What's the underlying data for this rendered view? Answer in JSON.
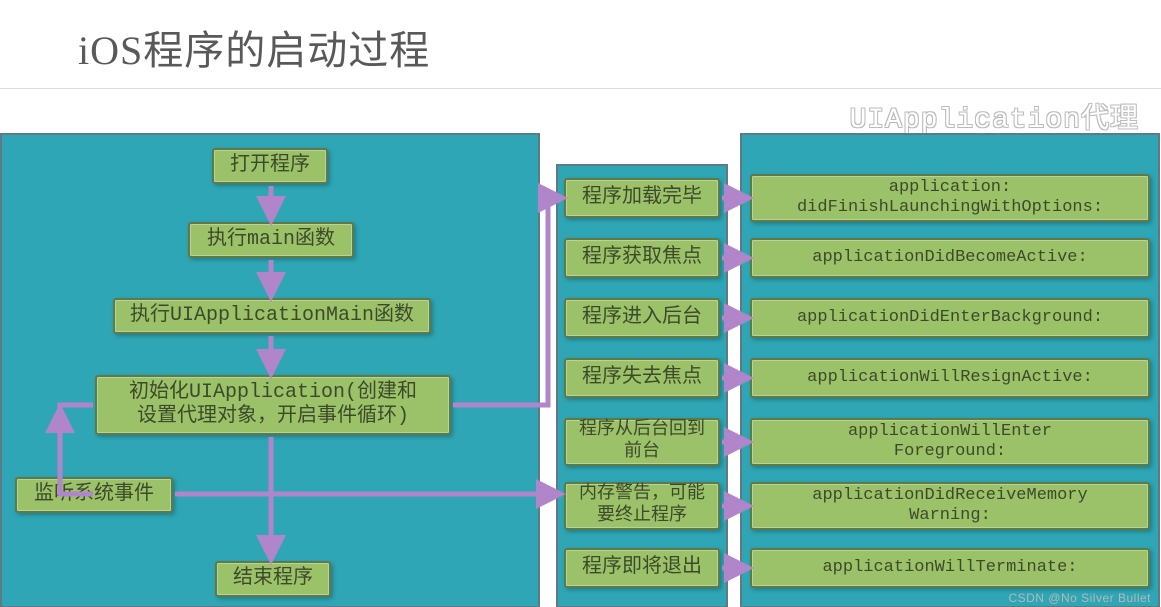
{
  "title": "iOS程序的启动过程",
  "delegate_label": "UIApplication代理",
  "watermark": "CSDN @No Silver Bullet",
  "left": {
    "open": "打开程序",
    "main": "执行main函数",
    "uiappmain": "执行UIApplicationMain函数",
    "init": "初始化UIApplication(创建和\n设置代理对象，开启事件循环)",
    "listen": "监听系统事件",
    "end": "结束程序"
  },
  "events": [
    "程序加载完毕",
    "程序获取焦点",
    "程序进入后台",
    "程序失去焦点",
    "程序从后台回到\n前台",
    "内存警告，可能\n要终止程序",
    "程序即将退出"
  ],
  "delegates": [
    "application:\ndidFinishLaunchingWithOptions:",
    "applicationDidBecomeActive:",
    "applicationDidEnterBackground:",
    "applicationWillResignActive:",
    "applicationWillEnter\nForeground:",
    "applicationDidReceiveMemory\nWarning:",
    "applicationWillTerminate:"
  ],
  "chart_data": {
    "type": "area",
    "title": "iOS程序的启动过程",
    "left_flow": [
      "打开程序",
      "执行main函数",
      "执行UIApplicationMain函数",
      "初始化UIApplication(创建和设置代理对象，开启事件循环)",
      "监听系统事件",
      "结束程序"
    ],
    "left_edges": [
      [
        "打开程序",
        "执行main函数"
      ],
      [
        "执行main函数",
        "执行UIApplicationMain函数"
      ],
      [
        "执行UIApplicationMain函数",
        "初始化UIApplication(创建和设置代理对象，开启事件循环)"
      ],
      [
        "初始化UIApplication(创建和设置代理对象，开启事件循环)",
        "监听系统事件"
      ],
      [
        "监听系统事件",
        "初始化UIApplication(创建和设置代理对象，开启事件循环)"
      ],
      [
        "监听系统事件",
        "结束程序"
      ],
      [
        "监听系统事件",
        "→ events"
      ]
    ],
    "event_delegate_pairs": [
      [
        "程序加载完毕",
        "application:didFinishLaunchingWithOptions:"
      ],
      [
        "程序获取焦点",
        "applicationDidBecomeActive:"
      ],
      [
        "程序进入后台",
        "applicationDidEnterBackground:"
      ],
      [
        "程序失去焦点",
        "applicationWillResignActive:"
      ],
      [
        "程序从后台回到前台",
        "applicationWillEnterForeground:"
      ],
      [
        "内存警告，可能要终止程序",
        "applicationDidReceiveMemoryWarning:"
      ],
      [
        "程序即将退出",
        "applicationWillTerminate:"
      ]
    ],
    "delegate_container_label": "UIApplication代理"
  }
}
